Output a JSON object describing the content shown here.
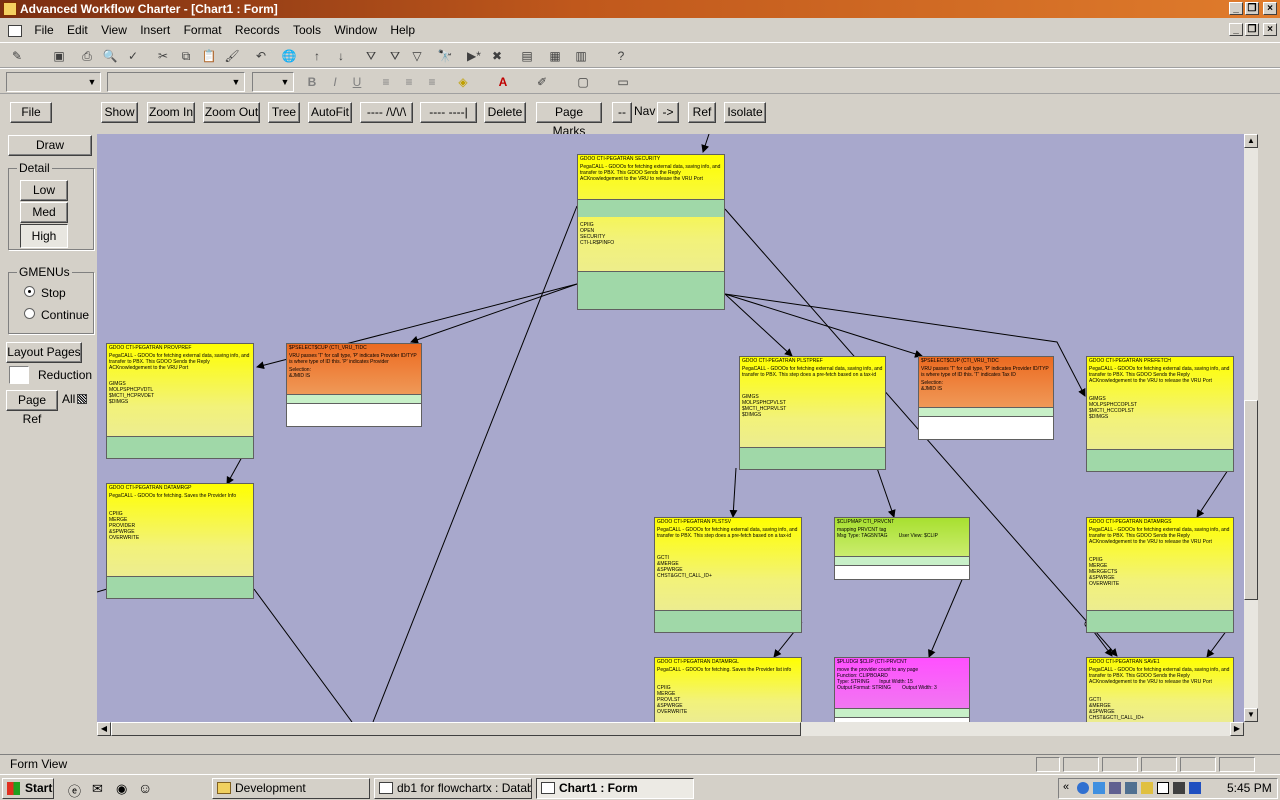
{
  "window": {
    "title": "Advanced Workflow Charter - [Chart1 : Form]"
  },
  "menu": [
    "File",
    "Edit",
    "View",
    "Insert",
    "Format",
    "Records",
    "Tools",
    "Window",
    "Help"
  ],
  "form_toolbar": {
    "file": "File",
    "show": "Show",
    "zoom_in": "Zoom In",
    "zoom_out": "Zoom Out",
    "tree": "Tree",
    "autofit": "AutoFit",
    "line1": "---- /\\/\\/\\",
    "line2": "----   ----|",
    "delete": "Delete",
    "page_marks": "Page Marks",
    "dash": "--",
    "nav": "Nav",
    "arrow": "->",
    "ref": "Ref",
    "isolate": "Isolate"
  },
  "side": {
    "draw": "Draw",
    "detail_label": "Detail",
    "low": "Low",
    "med": "Med",
    "high": "High",
    "gmenus_label": "GMENUs",
    "stop": "Stop",
    "continue": "Continue",
    "layout_pages": "Layout Pages",
    "reduction": "Reduction",
    "page_ref": "Page Ref",
    "all": "All"
  },
  "nodes": {
    "n1": {
      "title": "GDOO CTI-PEGATRAN SECURITY",
      "desc": "PegaCALL - GDOOs for fetching external data, saving info, and transfer to PBX. This GDOO Sends the Reply ACKnowledgement to the VRU to release the VRU Port",
      "fields": "CPIIG\nOPEN\nSECURITY\nCTI-LR$PINFO"
    },
    "n2": {
      "title": "GDOO CTI-PEGATRAN PROVPREF",
      "desc": "PegaCALL - GDOOs for fetching external data, saving info, and transfer to PBX. This GDOO Sends the Reply ACKnowledgement to the VRU Port",
      "fields": "GIMGS\nMOLPSPHCPVDTL\n$MCTI_HCPRVDET\n$DIMGS"
    },
    "n3": {
      "title": "$PSELECT$CUP (CTI_VRU_TIDC",
      "desc": "VRU passes 'T' for call type, 'P' indicates Provider ID/TYP is where type of ID this. 'P' indicates Provider",
      "fields": "Selection:\n&JMID IS"
    },
    "n4": {
      "title": "GDOO CTI-PEGATRAN PLSTPREF",
      "desc": "PegaCALL - GDOOs for fetching external data, saving info, and transfer to PBX. This step does a pre-fetch based on a tax-id",
      "fields": "GIMGS\nMOLPSPHCPVLST\n$MCTI_HCPRVLST\n$DIMGS"
    },
    "n5": {
      "title": "$PSELECT$CUP (CTI_VRU_TIDC",
      "desc": "VRU passes 'T' for call type, 'P' indicates Provider ID/TYP is where type of ID this. 'T' indicates Tax ID",
      "fields": "Selection:\n&JMID IS"
    },
    "n6": {
      "title": "GDOO CTI-PEGATRAN PREFETCH",
      "desc": "PegaCALL - GDOOs for fetching external data, saving info, and transfer to PBX. This GDOO Sends the Reply ACKnowledgement to the VRU to release the VRU Port",
      "fields": "GIMGS\nMOLPSPHCCOPLST\n$MCTI_HCCOPLST\n$DIMGS"
    },
    "n7": {
      "title": "GDOO CTI-PEGATRAN DATAMRGP",
      "desc": "PegaCALL - GDOOs for fetching. Saves the Provider Info",
      "fields": "CPIIG\nMERGE\nPROVIDER\n&SPWRGE\nOVERWRITE"
    },
    "n8": {
      "title": "GDOO CTI-PEGATRAN PLSTSV",
      "desc": "PegaCALL - GDOOs for fetching external data, saving info, and transfer to PBX. This step does a pre-fetch based on a tax-id",
      "fields": "GCTI\n&MERGE\n&SPWRGE\nCHST&GCTI_CALL_ID+"
    },
    "n9": {
      "title": "$CLIPMAP CTI_PRVCNT",
      "desc": "mapping PRVCNT tag\nMsg Type: TAG5NTAG        User View: $CLIP",
      "fields": ""
    },
    "n10": {
      "title": "GDOO CTI-PEGATRAN DATAMRGS",
      "desc": "PegaCALL - GDOOs for fetching external data, saving info, and transfer to PBX. This GDOO Sends the Reply ACKnowledgement to the VRU to release the VRU Port",
      "fields": "CPIIG\nMERGE\nMERGECTS\n&SPWRGE\nOVERWRITE"
    },
    "n11": {
      "title": "GDOO CTI-PEGATRAN DATAMRGL",
      "desc": "PegaCALL - GDOOs for fetching. Saves the Provider list info",
      "fields": "CPIIG\nMERGE\nPROVLST\n&SPWRGE\nOVERWRITE"
    },
    "n12": {
      "title": "$PLUDGI $CLIP (CTI-PRVCNT",
      "desc": "move the provider count to any page\nFunction: CLIPBOARD\nType: STRING       Input Width: 15\nOutput Format: STRING        Output Width: 3",
      "fields": ""
    },
    "n13": {
      "title": "GDOO CTI-PEGATRAN SAVE1",
      "desc": "PegaCALL - GDOOs for fetching external data, saving info, and transfer to PBX. This GDOO Sends the Reply ACKnowledgement to the VRU to release the VRU Port",
      "fields": "GCTI\n&MERGE\n&SPWRGE\nCHST&GCTI_CALL_ID+"
    }
  },
  "status": {
    "left": "Form View"
  },
  "taskbar": {
    "start": "Start",
    "tasks": [
      "Development",
      "db1 for flowchartx : Datab...",
      "Chart1 : Form"
    ],
    "clock": "5:45 PM"
  },
  "colors": {
    "canvas": "#a8a8cc",
    "node_yellow": "#ffff00",
    "node_orange": "#ec6a20",
    "band_green": "#a0d8a8",
    "titlebar": "#c0581c"
  }
}
